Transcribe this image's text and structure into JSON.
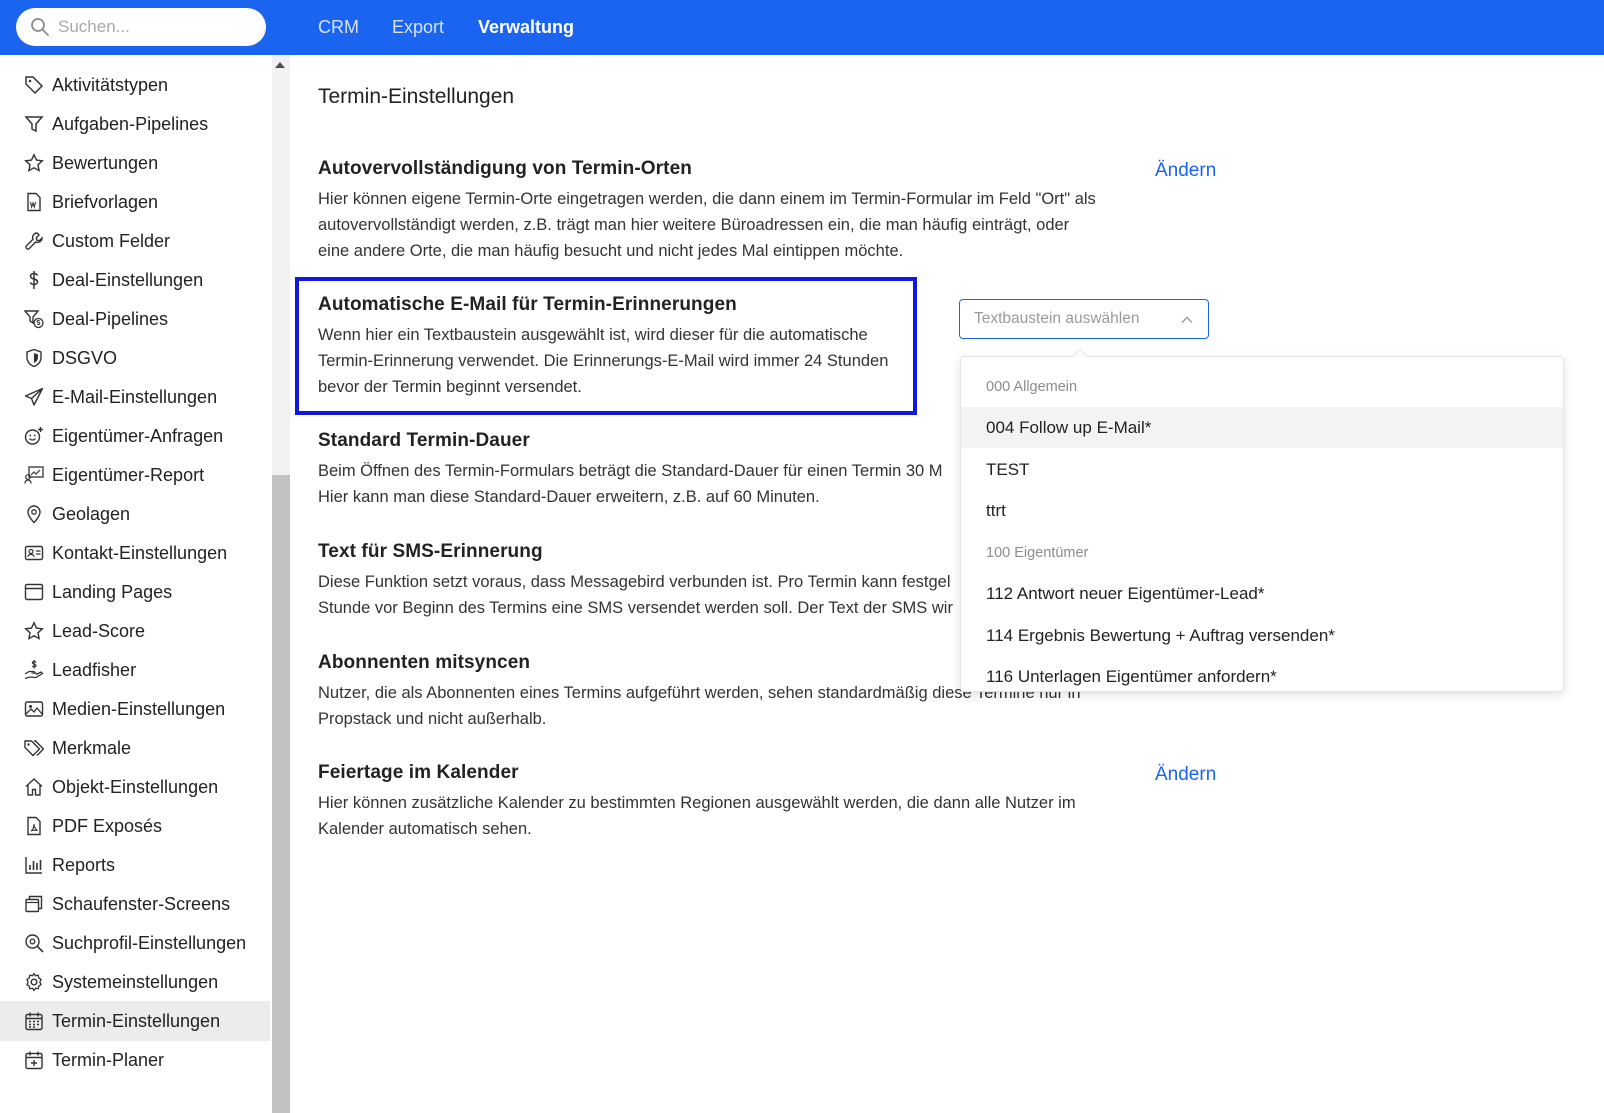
{
  "topbar": {
    "search_placeholder": "Suchen...",
    "nav": [
      "CRM",
      "Export",
      "Verwaltung"
    ],
    "active_nav": "Verwaltung",
    "accent_color": "#1b64f0"
  },
  "sidebar": {
    "items": [
      {
        "label": "Aktivitätstypen",
        "icon": "tag-icon"
      },
      {
        "label": "Aufgaben-Pipelines",
        "icon": "filter-icon"
      },
      {
        "label": "Bewertungen",
        "icon": "star-icon"
      },
      {
        "label": "Briefvorlagen",
        "icon": "word-document-icon"
      },
      {
        "label": "Custom Felder",
        "icon": "wrench-icon"
      },
      {
        "label": "Deal-Einstellungen",
        "icon": "dollar-icon"
      },
      {
        "label": "Deal-Pipelines",
        "icon": "funnel-dollar-icon"
      },
      {
        "label": "DSGVO",
        "icon": "shield-icon"
      },
      {
        "label": "E-Mail-Einstellungen",
        "icon": "paper-plane-icon"
      },
      {
        "label": "Eigentümer-Anfragen",
        "icon": "smiley-plus-icon"
      },
      {
        "label": "Eigentümer-Report",
        "icon": "chart-report-icon"
      },
      {
        "label": "Geolagen",
        "icon": "map-pin-icon"
      },
      {
        "label": "Kontakt-Einstellungen",
        "icon": "contact-card-icon"
      },
      {
        "label": "Landing Pages",
        "icon": "browser-window-icon"
      },
      {
        "label": "Lead-Score",
        "icon": "star-icon"
      },
      {
        "label": "Leadfisher",
        "icon": "hand-dollar-icon"
      },
      {
        "label": "Medien-Einstellungen",
        "icon": "image-icon"
      },
      {
        "label": "Merkmale",
        "icon": "tags-icon"
      },
      {
        "label": "Objekt-Einstellungen",
        "icon": "house-icon"
      },
      {
        "label": "PDF Exposés",
        "icon": "pdf-file-icon"
      },
      {
        "label": "Reports",
        "icon": "bar-chart-icon"
      },
      {
        "label": "Schaufenster-Screens",
        "icon": "stacked-windows-icon"
      },
      {
        "label": "Suchprofil-Einstellungen",
        "icon": "search-gear-icon"
      },
      {
        "label": "Systemeinstellungen",
        "icon": "gear-icon"
      },
      {
        "label": "Termin-Einstellungen",
        "icon": "calendar-icon"
      },
      {
        "label": "Termin-Planer",
        "icon": "calendar-plus-icon"
      }
    ],
    "selected": "Termin-Einstellungen"
  },
  "main": {
    "page_title": "Termin-Einstellungen",
    "sections": [
      {
        "title": "Autovervollständigung von Termin-Orten",
        "desc_lines": [
          "Hier können eigene Termin-Orte eingetragen werden, die dann einem im Termin-Formular im Feld \"Ort\" als",
          "autovervollständigt werden, z.B. trägt man hier weitere Büroadressen ein, die man häufig einträgt, oder",
          "eine andere Orte, die man häufig besucht und nicht jedes Mal eintippen möchte."
        ],
        "action": "Ändern"
      },
      {
        "title": "Automatische E-Mail für Termin-Erinnerungen",
        "desc_lines": [
          "Wenn hier ein Textbaustein ausgewählt ist, wird dieser für die automatische",
          "Termin-Erinnerung verwendet. Die Erinnerungs-E-Mail wird immer 24 Stunden",
          "bevor der Termin beginnt versendet."
        ],
        "select_placeholder": "Textbaustein auswählen"
      },
      {
        "title": "Standard Termin-Dauer",
        "desc_lines": [
          "Beim Öffnen des Termin-Formulars beträgt die Standard-Dauer für einen Termin 30 M",
          "Hier kann man diese Standard-Dauer erweitern, z.B. auf 60 Minuten."
        ]
      },
      {
        "title": "Text für SMS-Erinnerung",
        "desc_lines": [
          "Diese Funktion setzt voraus, dass Messagebird verbunden ist. Pro Termin kann festgel",
          "Stunde vor Beginn des Termins eine SMS versendet werden soll. Der Text der SMS wir"
        ]
      },
      {
        "title": "Abonnenten mitsyncen",
        "desc_lines": [
          "Nutzer, die als Abonnenten eines Termins aufgeführt werden, sehen standardmäßig diese Termine nur in",
          "Propstack und nicht außerhalb."
        ]
      },
      {
        "title": "Feiertage im Kalender",
        "desc_lines": [
          "Hier können zusätzliche Kalender zu bestimmten Regionen ausgewählt werden, die dann alle Nutzer im",
          "Kalender automatisch sehen."
        ],
        "action": "Ändern"
      }
    ]
  },
  "dropdown": {
    "options": [
      {
        "label": "000 Allgemein",
        "type": "group"
      },
      {
        "label": "004 Follow up E-Mail*",
        "type": "option",
        "hovered": true
      },
      {
        "label": "TEST",
        "type": "option"
      },
      {
        "label": "ttrt",
        "type": "option"
      },
      {
        "label": "100 Eigentümer",
        "type": "group"
      },
      {
        "label": "112 Antwort neuer Eigentümer-Lead*",
        "type": "option"
      },
      {
        "label": "114 Ergebnis Bewertung + Auftrag versenden*",
        "type": "option"
      },
      {
        "label": "116 Unterlagen Eigentümer anfordern*",
        "type": "option"
      }
    ]
  }
}
